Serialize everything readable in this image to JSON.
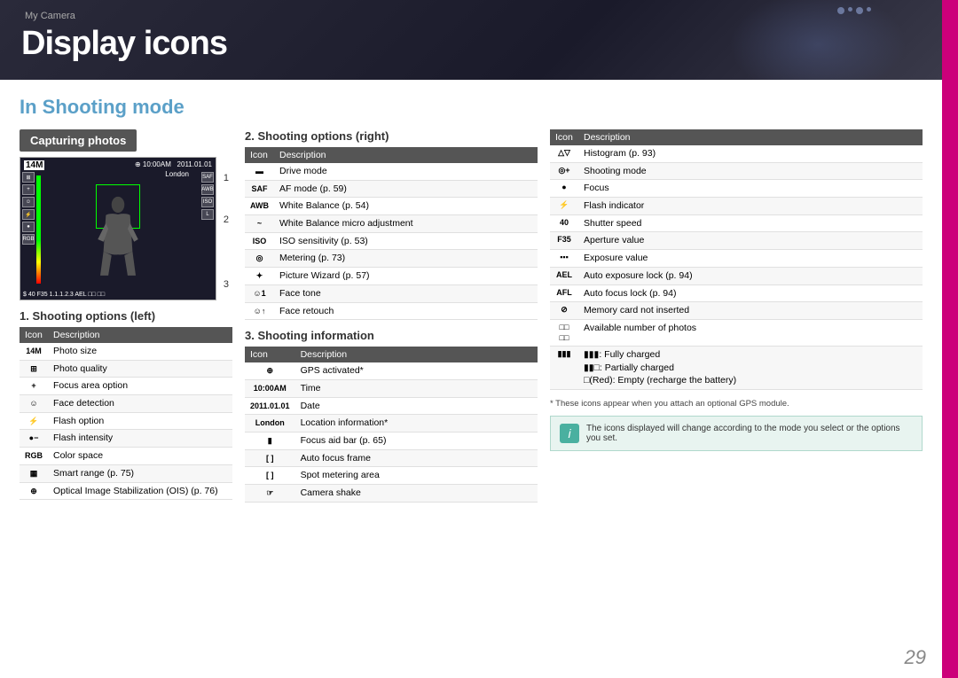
{
  "breadcrumb": "My Camera",
  "title": "Display icons",
  "section_title": "In Shooting mode",
  "capturing_badge": "Capturing photos",
  "label_1": "1",
  "label_2": "2",
  "label_3": "3",
  "shooting_left": {
    "heading": "1. Shooting options (left)",
    "col_icon": "Icon",
    "col_desc": "Description",
    "rows": [
      {
        "icon": "14M",
        "desc": "Photo size"
      },
      {
        "icon": "⊞",
        "desc": "Photo quality"
      },
      {
        "icon": "+",
        "desc": "Focus area option"
      },
      {
        "icon": "☺",
        "desc": "Face detection"
      },
      {
        "icon": "⚡",
        "desc": "Flash option"
      },
      {
        "icon": "●−",
        "desc": "Flash intensity"
      },
      {
        "icon": "RGB",
        "desc": "Color space"
      },
      {
        "icon": "▦",
        "desc": "Smart range (p. 75)"
      },
      {
        "icon": "⊕",
        "desc": "Optical Image Stabilization (OIS) (p. 76)"
      }
    ]
  },
  "shooting_right": {
    "heading": "2. Shooting options (right)",
    "col_icon": "Icon",
    "col_desc": "Description",
    "rows": [
      {
        "icon": "▬",
        "desc": "Drive mode"
      },
      {
        "icon": "SAF",
        "desc": "AF mode (p. 59)"
      },
      {
        "icon": "AWB",
        "desc": "White Balance (p. 54)"
      },
      {
        "icon": "~",
        "desc": "White Balance micro adjustment"
      },
      {
        "icon": "ISO",
        "desc": "ISO sensitivity (p. 53)"
      },
      {
        "icon": "◎",
        "desc": "Metering (p. 73)"
      },
      {
        "icon": "✦",
        "desc": "Picture Wizard (p. 57)"
      },
      {
        "icon": "☺1",
        "desc": "Face tone"
      },
      {
        "icon": "☺↑",
        "desc": "Face retouch"
      }
    ]
  },
  "shooting_info": {
    "heading": "3. Shooting information",
    "col_icon": "Icon",
    "col_desc": "Description",
    "rows": [
      {
        "icon": "⊕",
        "desc": "GPS activated*"
      },
      {
        "icon": "10:00AM",
        "desc": "Time"
      },
      {
        "icon": "2011.01.01",
        "desc": "Date"
      },
      {
        "icon": "London",
        "desc": "Location information*"
      },
      {
        "icon": "▮",
        "desc": "Focus aid bar (p. 65)"
      },
      {
        "icon": "[ ]",
        "desc": "Auto focus frame"
      },
      {
        "icon": "[ ]",
        "desc": "Spot metering area"
      },
      {
        "icon": "☞",
        "desc": "Camera shake"
      }
    ]
  },
  "shooting_right2": {
    "col_icon": "Icon",
    "col_desc": "Description",
    "rows": [
      {
        "icon": "△▽",
        "desc": "Histogram (p. 93)"
      },
      {
        "icon": "◎+",
        "desc": "Shooting mode"
      },
      {
        "icon": "●",
        "desc": "Focus"
      },
      {
        "icon": "⚡",
        "desc": "Flash indicator"
      },
      {
        "icon": "40",
        "desc": "Shutter speed"
      },
      {
        "icon": "F35",
        "desc": "Aperture value"
      },
      {
        "icon": "▪▪▪",
        "desc": "Exposure value"
      },
      {
        "icon": "AEL",
        "desc": "Auto exposure lock (p. 94)"
      },
      {
        "icon": "AFL",
        "desc": "Auto focus lock (p. 94)"
      },
      {
        "icon": "⊘",
        "desc": "Memory card not inserted"
      },
      {
        "icon": "□□ □□",
        "desc": "Available number of photos"
      },
      {
        "icon": "▮▮▮",
        "desc": "▮▮▮: Fully charged\n▮▮□: Partially charged\n□(Red): Empty (recharge the battery)"
      }
    ]
  },
  "footnote": "* These icons appear when you attach an optional GPS module.",
  "info_box_text": "The icons displayed will change according to the mode you select or the options you set.",
  "page_number": "29",
  "vf": {
    "top_left": "14M",
    "time": "10:00AM",
    "date": "2011.01.01",
    "location": "London",
    "bottom": "$ 40 F35 1..1..1..2..3 AEL □□ □□"
  }
}
